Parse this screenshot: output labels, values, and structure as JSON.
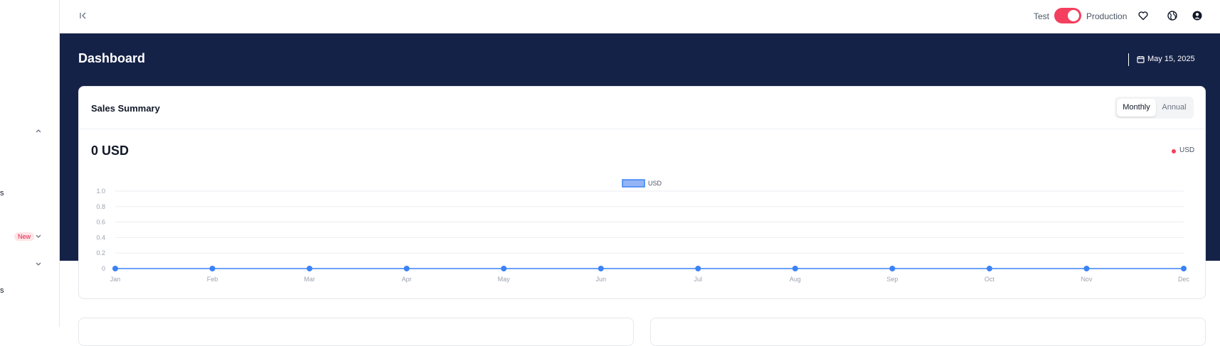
{
  "sidebar": {
    "item_a": "s",
    "badge": "New",
    "item_b": "s"
  },
  "topbar": {
    "env_test": "Test",
    "env_production": "Production",
    "toggle_on": true,
    "icons": [
      "collapse-icon",
      "heart-icon",
      "globe-icon",
      "user-icon"
    ]
  },
  "header": {
    "title": "Dashboard",
    "date": "May 15, 2025"
  },
  "sales": {
    "title": "Sales Summary",
    "period_monthly": "Monthly",
    "period_annual": "Annual",
    "active_period": "Monthly",
    "total": "0 USD",
    "legend": "USD"
  },
  "colors": {
    "band": "#152247",
    "accent": "#f43f5e",
    "series": "#3b82f6"
  },
  "chart_data": {
    "type": "line",
    "x": [
      "Jan",
      "Feb",
      "Mar",
      "Apr",
      "May",
      "Jun",
      "Jul",
      "Aug",
      "Sep",
      "Oct",
      "Nov",
      "Dec"
    ],
    "series": [
      {
        "name": "USD",
        "values": [
          0,
          0,
          0,
          0,
          0,
          0,
          0,
          0,
          0,
          0,
          0,
          0
        ]
      }
    ],
    "yticks": [
      "0",
      "0.2",
      "0.4",
      "0.6",
      "0.8",
      "1.0"
    ],
    "ylim": [
      0,
      1
    ],
    "grid": true,
    "legend": "top-center"
  }
}
